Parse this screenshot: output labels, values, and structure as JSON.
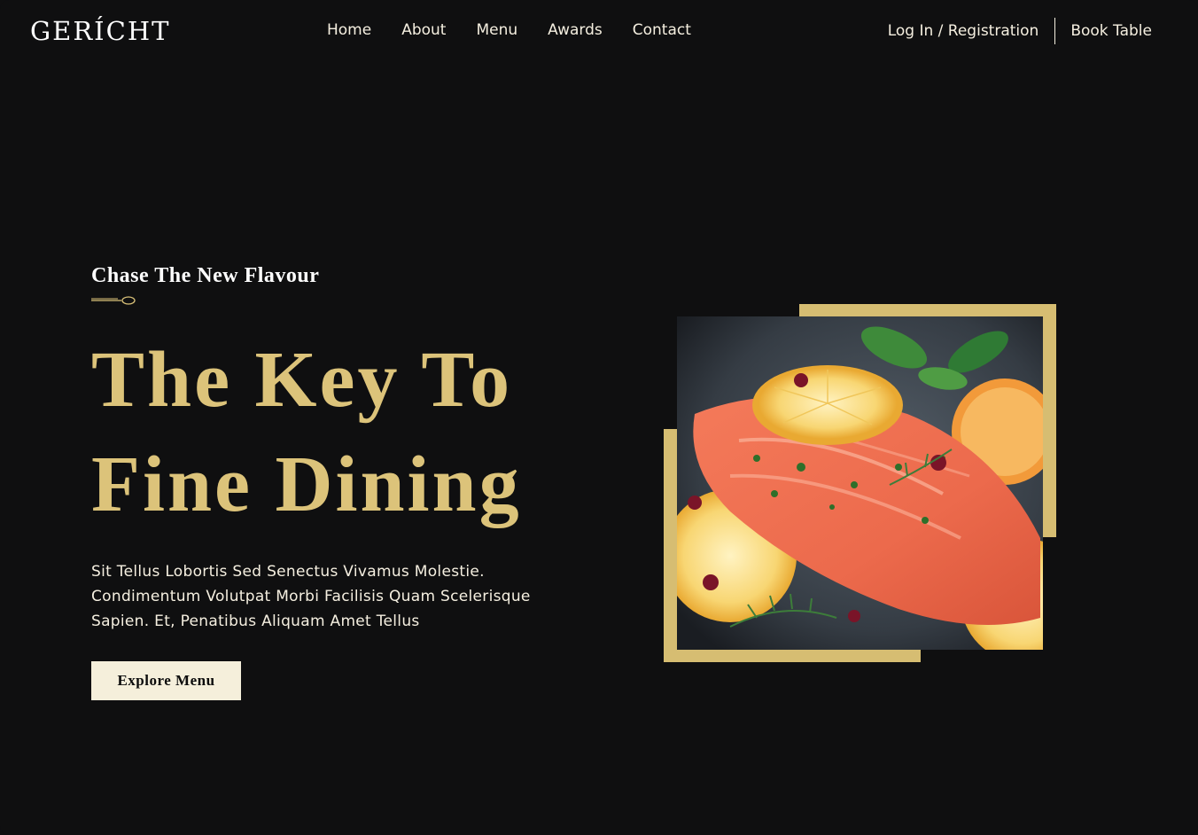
{
  "brand": {
    "logo": "GERÍCHT"
  },
  "nav": {
    "links": [
      "Home",
      "About",
      "Menu",
      "Awards",
      "Contact"
    ],
    "auth": "Log In / Registration",
    "book": "Book Table"
  },
  "hero": {
    "subtitle": "Chase The New Flavour",
    "headline_line1": "The Key To",
    "headline_line2": "Fine Dining",
    "description": "Sit Tellus Lobortis Sed Senectus Vivamus Molestie. Condimentum Volutpat Morbi Facilisis Quam Scelerisque Sapien. Et, Penatibus Aliquam Amet Tellus",
    "button": "Explore Menu"
  },
  "colors": {
    "background": "#0f0f10",
    "accent_gold": "#dcc37a",
    "button_bg": "#f5efdb",
    "text_light": "#f5efe0"
  },
  "icons": {
    "spoon": "spoon-icon",
    "food_photo": "salmon-dish-image"
  }
}
